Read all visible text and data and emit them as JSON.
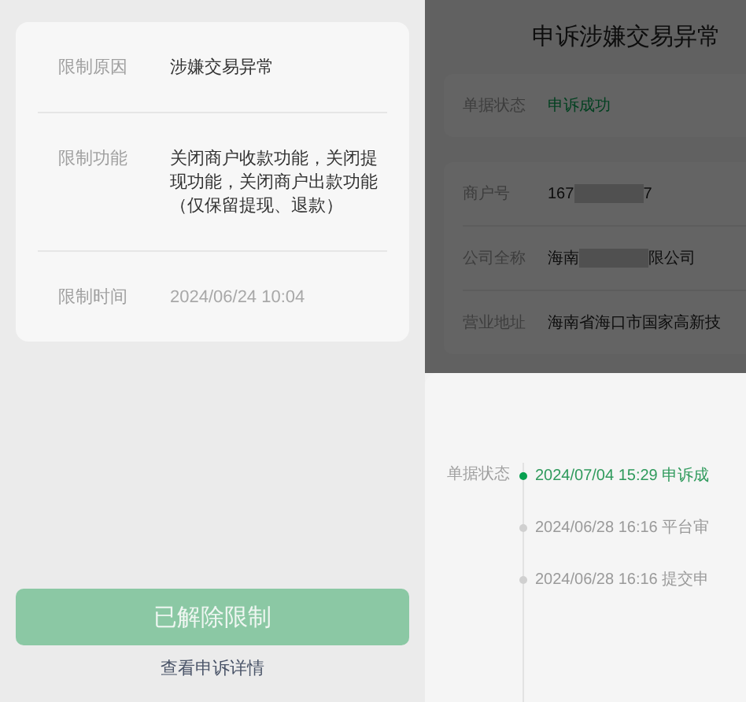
{
  "restriction_card": {
    "rows": [
      {
        "label": "限制原因",
        "value": "涉嫌交易异常",
        "muted": false
      },
      {
        "label": "限制功能",
        "value": "关闭商户收款功能，关闭提现功能，关闭商户出款功能（仅保留提现、退款）",
        "muted": false
      },
      {
        "label": "限制时间",
        "value": "2024/06/24 10:04",
        "muted": true
      }
    ]
  },
  "lifted_button": {
    "label": "已解除限制",
    "disabled": true
  },
  "details_link": "查看申诉详情",
  "appeal_page": {
    "title": "申诉涉嫌交易异常",
    "status_row": {
      "label": "单据状态",
      "value": "申诉成功"
    },
    "merchant_rows": [
      {
        "label": "商户号",
        "value_start": "167",
        "redacted": true,
        "value_end": "7"
      },
      {
        "label": "公司全称",
        "value_start": "海南",
        "redacted": true,
        "value_end": "限公司"
      },
      {
        "label": "营业地址",
        "value_start": "海南省海口市国家高新技",
        "value_end": ""
      }
    ]
  },
  "status_sheet": {
    "label": "单据状态",
    "timeline": [
      {
        "text": "2024/07/04 15:29 申诉成",
        "active": true
      },
      {
        "text": "2024/06/28 16:16 平台审",
        "active": false
      },
      {
        "text": "2024/06/28 16:16 提交申",
        "active": false
      }
    ]
  }
}
